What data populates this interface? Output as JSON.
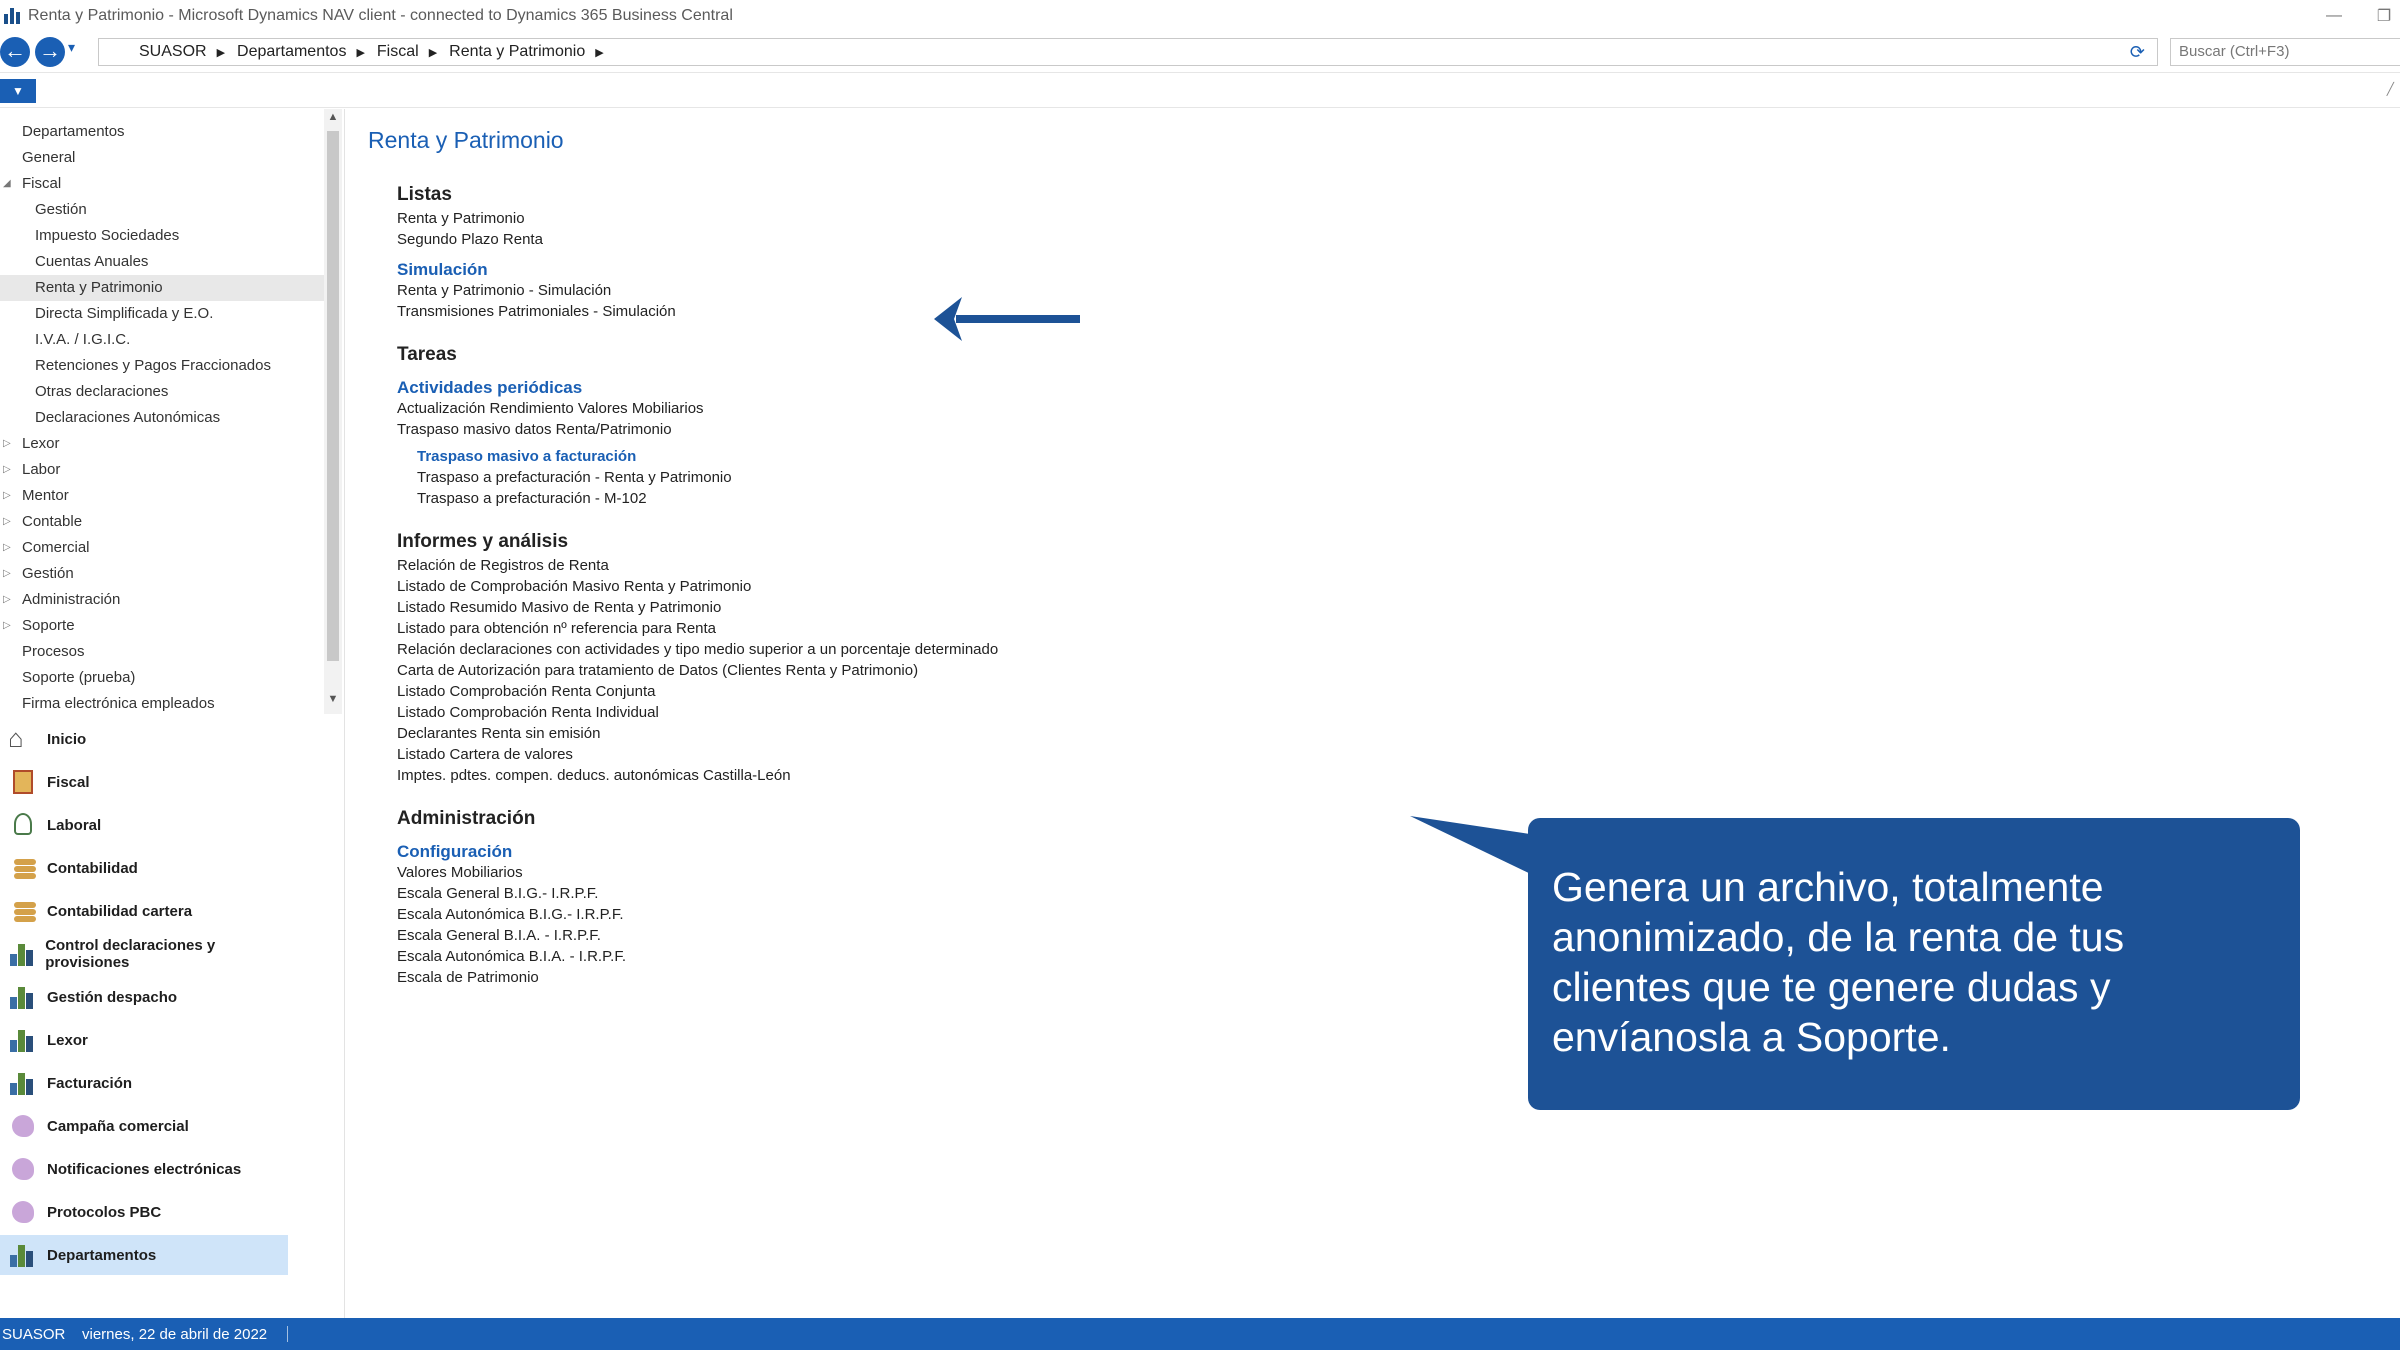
{
  "window": {
    "title": "Renta y Patrimonio - Microsoft Dynamics NAV client - connected to Dynamics 365 Business Central",
    "minimize": "—",
    "restore": "❐"
  },
  "nav": {
    "back": "←",
    "forward": "→",
    "dropdown": "▾",
    "breadcrumb": [
      "SUASOR",
      "Departamentos",
      "Fiscal",
      "Renta y Patrimonio"
    ],
    "refresh": "⟳",
    "search_placeholder": "Buscar (Ctrl+F3)"
  },
  "ribbon": {
    "toggle": "▼",
    "right_glyph": "╱"
  },
  "tree": {
    "scroll_up": "▲",
    "scroll_down": "▼",
    "items": [
      {
        "label": "Departamentos",
        "level": "root",
        "exp": ""
      },
      {
        "label": "General",
        "level": "root",
        "exp": ""
      },
      {
        "label": "Fiscal",
        "level": "root",
        "exp": "◢"
      },
      {
        "label": "Gestión",
        "level": "child",
        "exp": ""
      },
      {
        "label": "Impuesto Sociedades",
        "level": "child",
        "exp": ""
      },
      {
        "label": "Cuentas Anuales",
        "level": "child",
        "exp": ""
      },
      {
        "label": "Renta y Patrimonio",
        "level": "child",
        "exp": "",
        "selected": true
      },
      {
        "label": "Directa Simplificada y E.O.",
        "level": "child",
        "exp": ""
      },
      {
        "label": "I.V.A. / I.G.I.C.",
        "level": "child",
        "exp": ""
      },
      {
        "label": "Retenciones y Pagos Fraccionados",
        "level": "child",
        "exp": ""
      },
      {
        "label": "Otras declaraciones",
        "level": "child",
        "exp": ""
      },
      {
        "label": "Declaraciones Autonómicas",
        "level": "child",
        "exp": ""
      },
      {
        "label": "Lexor",
        "level": "root",
        "exp": "▷"
      },
      {
        "label": "Labor",
        "level": "root",
        "exp": "▷"
      },
      {
        "label": "Mentor",
        "level": "root",
        "exp": "▷"
      },
      {
        "label": "Contable",
        "level": "root",
        "exp": "▷"
      },
      {
        "label": "Comercial",
        "level": "root",
        "exp": "▷"
      },
      {
        "label": "Gestión",
        "level": "root",
        "exp": "▷"
      },
      {
        "label": "Administración",
        "level": "root",
        "exp": "▷"
      },
      {
        "label": "Soporte",
        "level": "root",
        "exp": "▷"
      },
      {
        "label": "Procesos",
        "level": "root",
        "exp": ""
      },
      {
        "label": "Soporte (prueba)",
        "level": "root",
        "exp": ""
      },
      {
        "label": "Firma electrónica empleados",
        "level": "root",
        "exp": ""
      }
    ]
  },
  "modules": [
    {
      "label": "Inicio",
      "icon": "home-icon"
    },
    {
      "label": "Fiscal",
      "icon": "fiscal-icon"
    },
    {
      "label": "Laboral",
      "icon": "laboral-icon"
    },
    {
      "label": "Contabilidad",
      "icon": "coins-icon"
    },
    {
      "label": "Contabilidad cartera",
      "icon": "coins-icon"
    },
    {
      "label": "Control declaraciones y provisiones",
      "icon": "bar-chart-icon"
    },
    {
      "label": "Gestión despacho",
      "icon": "bar-chart-icon"
    },
    {
      "label": "Lexor",
      "icon": "bar-chart-icon"
    },
    {
      "label": "Facturación",
      "icon": "bar-chart-icon"
    },
    {
      "label": "Campaña comercial",
      "icon": "blob-icon"
    },
    {
      "label": "Notificaciones electrónicas",
      "icon": "blob-icon"
    },
    {
      "label": "Protocolos PBC",
      "icon": "blob-icon"
    },
    {
      "label": "Departamentos",
      "icon": "bar-chart-icon",
      "active": true
    }
  ],
  "status": {
    "company": "SUASOR",
    "date": "viernes, 22 de abril de 2022"
  },
  "content": {
    "page_title": "Renta y Patrimonio",
    "blocks": [
      {
        "type": "section",
        "text": "Listas"
      },
      {
        "type": "link",
        "text": "Renta y Patrimonio"
      },
      {
        "type": "link",
        "text": "Segundo Plazo Renta"
      },
      {
        "type": "group",
        "text": "Simulación"
      },
      {
        "type": "link",
        "text": "Renta y Patrimonio - Simulación"
      },
      {
        "type": "link",
        "text": "Transmisiones Patrimoniales - Simulación"
      },
      {
        "type": "section",
        "text": "Tareas"
      },
      {
        "type": "group",
        "text": "Actividades periódicas"
      },
      {
        "type": "link",
        "text": "Actualización Rendimiento Valores Mobiliarios"
      },
      {
        "type": "link",
        "text": "Traspaso masivo datos Renta/Patrimonio"
      },
      {
        "type": "subgroup",
        "text": "Traspaso masivo a facturación"
      },
      {
        "type": "sublink",
        "text": "Traspaso a prefacturación - Renta y Patrimonio"
      },
      {
        "type": "sublink",
        "text": "Traspaso a prefacturación - M-102"
      },
      {
        "type": "section",
        "text": "Informes y análisis"
      },
      {
        "type": "link",
        "text": "Relación de Registros de Renta"
      },
      {
        "type": "link",
        "text": "Listado de Comprobación Masivo Renta y Patrimonio"
      },
      {
        "type": "link",
        "text": "Listado Resumido Masivo de Renta y Patrimonio"
      },
      {
        "type": "link",
        "text": "Listado para obtención nº referencia para Renta"
      },
      {
        "type": "link",
        "text": "Relación declaraciones con actividades y tipo medio superior a un porcentaje determinado"
      },
      {
        "type": "link",
        "text": "Carta de Autorización para tratamiento de Datos (Clientes Renta y Patrimonio)"
      },
      {
        "type": "link",
        "text": "Listado Comprobación Renta Conjunta"
      },
      {
        "type": "link",
        "text": "Listado Comprobación Renta Individual"
      },
      {
        "type": "link",
        "text": "Declarantes Renta sin emisión"
      },
      {
        "type": "link",
        "text": "Listado Cartera de valores"
      },
      {
        "type": "link",
        "text": "Imptes. pdtes. compen. deducs. autonómicas Castilla-León"
      },
      {
        "type": "section",
        "text": "Administración"
      },
      {
        "type": "group",
        "text": "Configuración"
      },
      {
        "type": "link",
        "text": "Valores Mobiliarios"
      },
      {
        "type": "link",
        "text": "Escala General B.I.G.- I.R.P.F."
      },
      {
        "type": "link",
        "text": "Escala Autonómica B.I.G.- I.R.P.F."
      },
      {
        "type": "link",
        "text": "Escala General B.I.A. - I.R.P.F."
      },
      {
        "type": "link",
        "text": "Escala Autonómica B.I.A. - I.R.P.F."
      },
      {
        "type": "link",
        "text": "Escala de Patrimonio"
      }
    ]
  },
  "callout": {
    "text": "Genera un archivo, totalmente anonimizado, de la renta de tus clientes que te genere dudas y envíanosla a Soporte.",
    "color": "#1d5296"
  }
}
